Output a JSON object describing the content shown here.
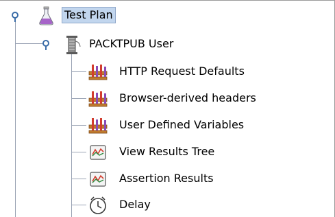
{
  "tree": {
    "root": {
      "label": "Test Plan",
      "icon": "test-plan-flask-icon",
      "expanded": true,
      "selected": true,
      "children": [
        {
          "label": "PACKTPUB User",
          "icon": "thread-group-spool-icon",
          "expanded": true,
          "children": [
            {
              "label": "HTTP Request Defaults",
              "icon": "config-element-icon"
            },
            {
              "label": "Browser-derived headers",
              "icon": "config-element-icon"
            },
            {
              "label": "User Defined Variables",
              "icon": "config-element-icon"
            },
            {
              "label": "View Results Tree",
              "icon": "listener-graph-icon"
            },
            {
              "label": "Assertion Results",
              "icon": "listener-graph-icon"
            },
            {
              "label": "Delay",
              "icon": "timer-clock-icon"
            }
          ]
        }
      ]
    }
  },
  "colors": {
    "selection_bg": "#c2d6ee",
    "selection_border": "#8fa7c9",
    "tree_line": "#9aa3b4",
    "handle": "#3b6da8"
  }
}
